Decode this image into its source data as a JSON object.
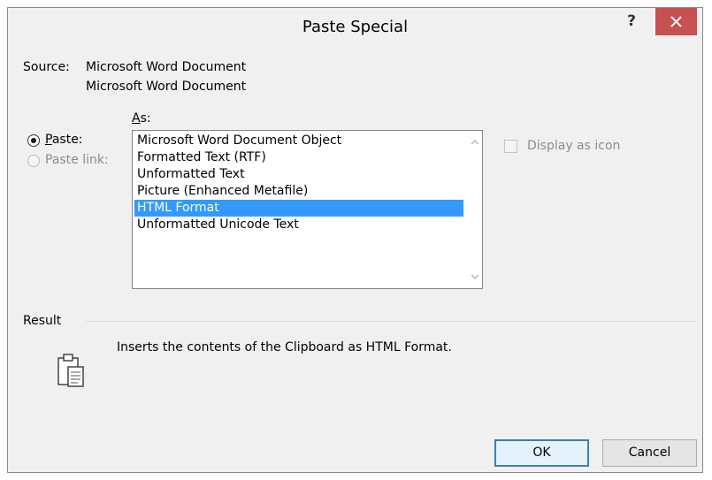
{
  "window": {
    "title": "Paste Special",
    "help_label": "?",
    "close_icon": "close-icon"
  },
  "source": {
    "label": "Source:",
    "line1": "Microsoft Word Document",
    "line2": "Microsoft Word Document"
  },
  "as_label": "As:",
  "paste_options": {
    "paste_label": "Paste:",
    "paste_link_label": "Paste link:",
    "selected": "Paste"
  },
  "format_list": {
    "items": [
      "Microsoft Word Document Object",
      "Formatted Text (RTF)",
      "Unformatted Text",
      "Picture (Enhanced Metafile)",
      "HTML Format",
      "Unformatted Unicode Text"
    ],
    "selected_index": 4
  },
  "display_as_icon": {
    "label": "Display as icon",
    "checked": false,
    "enabled": false
  },
  "result": {
    "label": "Result",
    "description": "Inserts the contents of the Clipboard as HTML Format.",
    "icon": "clipboard-icon"
  },
  "buttons": {
    "ok": "OK",
    "cancel": "Cancel"
  },
  "colors": {
    "selection": "#3399ff",
    "close_button": "#c75050",
    "dialog_bg": "#f0f0f0"
  }
}
